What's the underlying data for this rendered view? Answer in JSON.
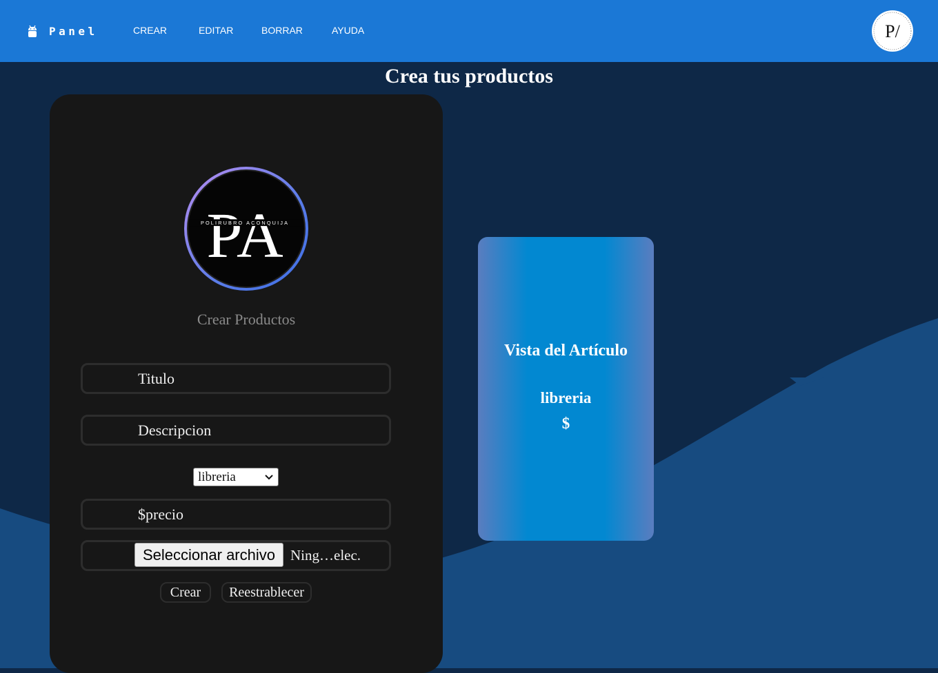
{
  "navbar": {
    "brand": "Panel",
    "items": [
      {
        "label": "CREAR"
      },
      {
        "label": "EDITAR"
      },
      {
        "label": "BORRAR"
      },
      {
        "label": "AYUDA"
      }
    ],
    "avatar_text": "P/"
  },
  "page": {
    "title": "Crea tus productos"
  },
  "form": {
    "logo_text": "PA",
    "logo_ring_text": "POLIRUBRO ACONQUIJA",
    "heading": "Crear Productos",
    "title_placeholder": "Titulo",
    "description_placeholder": "Descripcion",
    "category_selected": "libreria",
    "price_placeholder": "$precio",
    "file_button_label": "Seleccionar archivo",
    "file_status": "Ning…elec.",
    "create_button": "Crear",
    "reset_button": "Reestrablecer"
  },
  "preview": {
    "title": "Vista del Artículo",
    "category": "libreria",
    "price": "$"
  },
  "colors": {
    "navbar": "#1b78d6",
    "background": "#0e2847",
    "wave": "#174b80",
    "card": "#171717",
    "preview_accent": "#0288d1"
  }
}
